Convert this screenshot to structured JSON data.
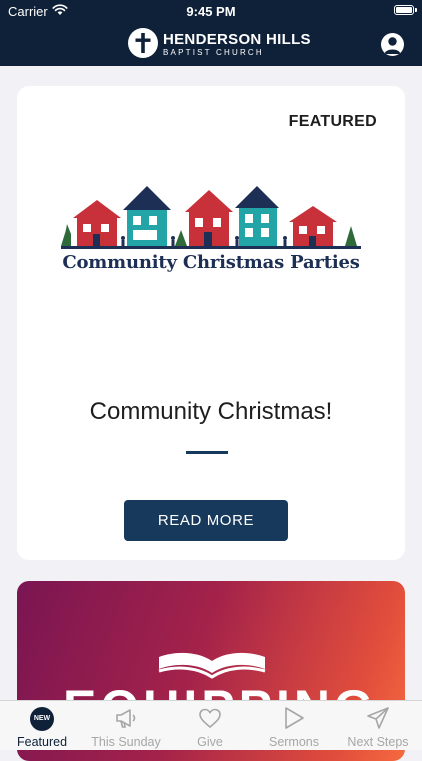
{
  "status_bar": {
    "carrier": "Carrier",
    "time": "9:45 PM"
  },
  "header": {
    "logo_name": "HENDERSON HILLS",
    "logo_subtitle": "BAPTIST CHURCH",
    "profile_icon": "person-icon"
  },
  "featured_card": {
    "label": "FEATURED",
    "image_text": "Community Christmas Parties",
    "title": "Community Christmas!",
    "button_label": "READ MORE"
  },
  "promo_card": {
    "partial_text": "EQUIPPING"
  },
  "tab_bar": {
    "tabs": [
      {
        "label": "Featured",
        "icon": "new-badge-icon",
        "badge": "NEW",
        "active": true
      },
      {
        "label": "This Sunday",
        "icon": "megaphone-icon"
      },
      {
        "label": "Give",
        "icon": "heart-icon"
      },
      {
        "label": "Sermons",
        "icon": "play-icon"
      },
      {
        "label": "Next Steps",
        "icon": "paper-plane-icon"
      }
    ]
  },
  "colors": {
    "navy": "#0f2039",
    "button": "#16395c",
    "tab_inactive": "#a6a6a6",
    "promo_gradient": [
      "#7a1552",
      "#f56a3f"
    ]
  }
}
